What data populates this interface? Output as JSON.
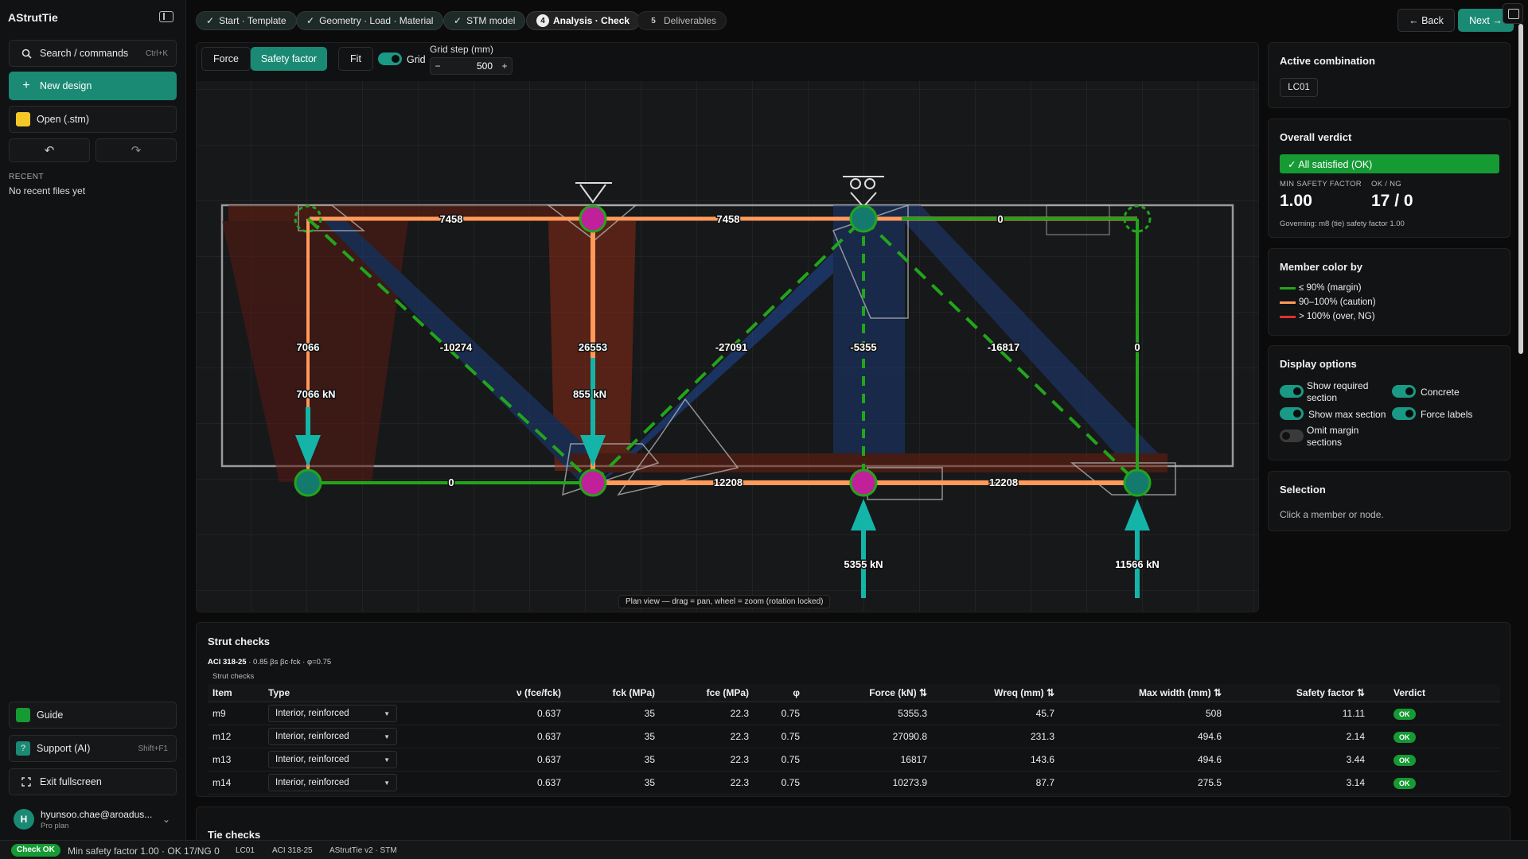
{
  "app": {
    "title": "AStrutTie"
  },
  "sidebar": {
    "search_label": "Search / commands",
    "search_kbd": "Ctrl+K",
    "new_design": "New design",
    "open_file": "Open (.stm)",
    "undo_icon": "undo-icon",
    "redo_icon": "redo-icon",
    "recent_heading": "RECENT",
    "recent_empty": "No recent files yet",
    "guide": "Guide",
    "support": "Support (AI)",
    "support_kbd": "Shift+F1",
    "exit_fullscreen": "Exit fullscreen",
    "user_initial": "H",
    "user_email": "hyunsoo.chae@aroadus...",
    "user_plan": "Pro plan"
  },
  "steps": [
    {
      "prefix": "✓",
      "label": "Start · Template"
    },
    {
      "prefix": "✓",
      "label": "Geometry · Load · Material"
    },
    {
      "prefix": "✓",
      "label": "STM model"
    },
    {
      "prefix": "4",
      "label": "Analysis · Check"
    },
    {
      "prefix": "5",
      "label": "Deliverables"
    }
  ],
  "nav": {
    "back": "← Back",
    "next": "Next →"
  },
  "toolbar": {
    "force": "Force",
    "safety_factor": "Safety factor",
    "fit": "Fit",
    "grid": "Grid",
    "grid_step_label": "Grid step (mm)",
    "grid_step_value": "500",
    "minus": "−",
    "plus": "+"
  },
  "canvas_hint": "Plan view — drag = pan, wheel = zoom (rotation locked)",
  "diagram": {
    "member_labels": {
      "top_left": "7458",
      "top_mid": "7458",
      "top_right": "0",
      "left_vert": "7066",
      "diag1": "-10274",
      "mid_vert": "26553",
      "diag2": "-27091",
      "right_vert": "-5355",
      "diag3": "-16817",
      "far_vert": "0",
      "bot_left": "0",
      "bot_mid": "12208",
      "bot_right": "12208"
    },
    "loads": [
      {
        "label": "7066 kN",
        "direction": "down"
      },
      {
        "label": "855 kN",
        "direction": "down"
      },
      {
        "label": "5355 kN",
        "direction": "up"
      },
      {
        "label": "11566 kN",
        "direction": "up"
      }
    ],
    "colors": {
      "ok": "#22a51b",
      "caution": "#ff9a5a",
      "ng": "#e03030",
      "node": "#c0219a",
      "load": "#14b5a8"
    }
  },
  "right": {
    "combo_title": "Active combination",
    "combo_value": "LC01",
    "verdict_title": "Overall verdict",
    "verdict_text": "✓ All satisfied (OK)",
    "min_sf_label": "MIN SAFETY FACTOR",
    "min_sf_value": "1.00",
    "okng_label": "OK / NG",
    "okng_value": "17 / 0",
    "governing": "Governing: m8 (tie) safety factor 1.00",
    "color_title": "Member color by",
    "legend": [
      "≤ 90% (margin)",
      "90–100% (caution)",
      "> 100% (over, NG)"
    ],
    "display_title": "Display options",
    "opt_required": "Show required section",
    "opt_concrete": "Concrete",
    "opt_max": "Show max section",
    "opt_force": "Force labels",
    "opt_omit": "Omit margin sections",
    "selection_title": "Selection",
    "selection_hint": "Click a member or node."
  },
  "strut_checks": {
    "title": "Strut checks",
    "code": "ACI 318-25",
    "formula": " · 0.85 βs βc·fck · φ=0.75",
    "caption": "Strut checks",
    "headers": [
      "Item",
      "Type",
      "ν (fce/fck)",
      "fck (MPa)",
      "fce (MPa)",
      "φ",
      "Force (kN) ⇅",
      "Wreq (mm) ⇅",
      "Max width (mm) ⇅",
      "Safety factor ⇅",
      "Verdict"
    ],
    "rows": [
      [
        "m9",
        "Interior, reinforced",
        "0.637",
        "35",
        "22.3",
        "0.75",
        "5355.3",
        "45.7",
        "508",
        "11.11",
        "OK"
      ],
      [
        "m12",
        "Interior, reinforced",
        "0.637",
        "35",
        "22.3",
        "0.75",
        "27090.8",
        "231.3",
        "494.6",
        "2.14",
        "OK"
      ],
      [
        "m13",
        "Interior, reinforced",
        "0.637",
        "35",
        "22.3",
        "0.75",
        "16817",
        "143.6",
        "494.6",
        "3.44",
        "OK"
      ],
      [
        "m14",
        "Interior, reinforced",
        "0.637",
        "35",
        "22.3",
        "0.75",
        "10273.9",
        "87.7",
        "275.5",
        "3.14",
        "OK"
      ]
    ]
  },
  "tie_checks": {
    "title": "Tie checks"
  },
  "status": {
    "badge": "Check OK",
    "summary": "Min safety factor 1.00 · OK 17/NG 0",
    "combo": "LC01",
    "code": "ACI 318-25",
    "version": "AStrutTie v2 · STM"
  }
}
